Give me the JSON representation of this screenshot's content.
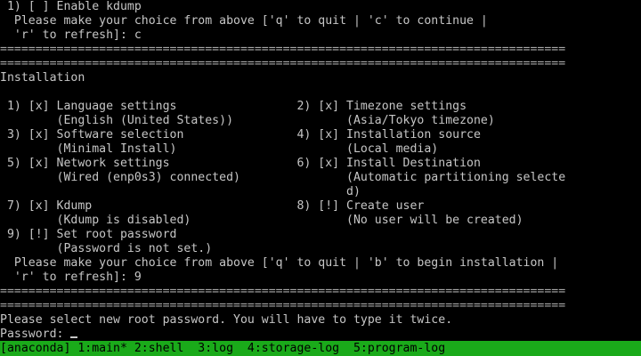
{
  "lines": [
    " 1) [ ] Enable kdump",
    "  Please make your choice from above ['q' to quit | 'c' to continue |",
    "  'r' to refresh]: c",
    "================================================================================",
    "================================================================================",
    "Installation",
    "",
    " 1) [x] Language settings                 2) [x] Timezone settings",
    "        (English (United States))                (Asia/Tokyo timezone)",
    " 3) [x] Software selection                4) [x] Installation source",
    "        (Minimal Install)                        (Local media)",
    " 5) [x] Network settings                  6) [x] Install Destination",
    "        (Wired (enp0s3) connected)               (Automatic partitioning selecte",
    "                                                 d)",
    " 7) [x] Kdump                             8) [!] Create user",
    "        (Kdump is disabled)                      (No user will be created)",
    " 9) [!] Set root password",
    "        (Password is not set.)",
    "  Please make your choice from above ['q' to quit | 'b' to begin installation |",
    "  'r' to refresh]: 9",
    "================================================================================",
    "================================================================================",
    "Please select new root password. You will have to type it twice.",
    "",
    "Password: "
  ],
  "statusbar": {
    "text": "[anaconda] 1:main* 2:shell  3:log  4:storage-log  5:program-log"
  },
  "colors": {
    "background": "#000000",
    "text": "#c6c6c6",
    "statusbar": "#1aaa1a"
  }
}
